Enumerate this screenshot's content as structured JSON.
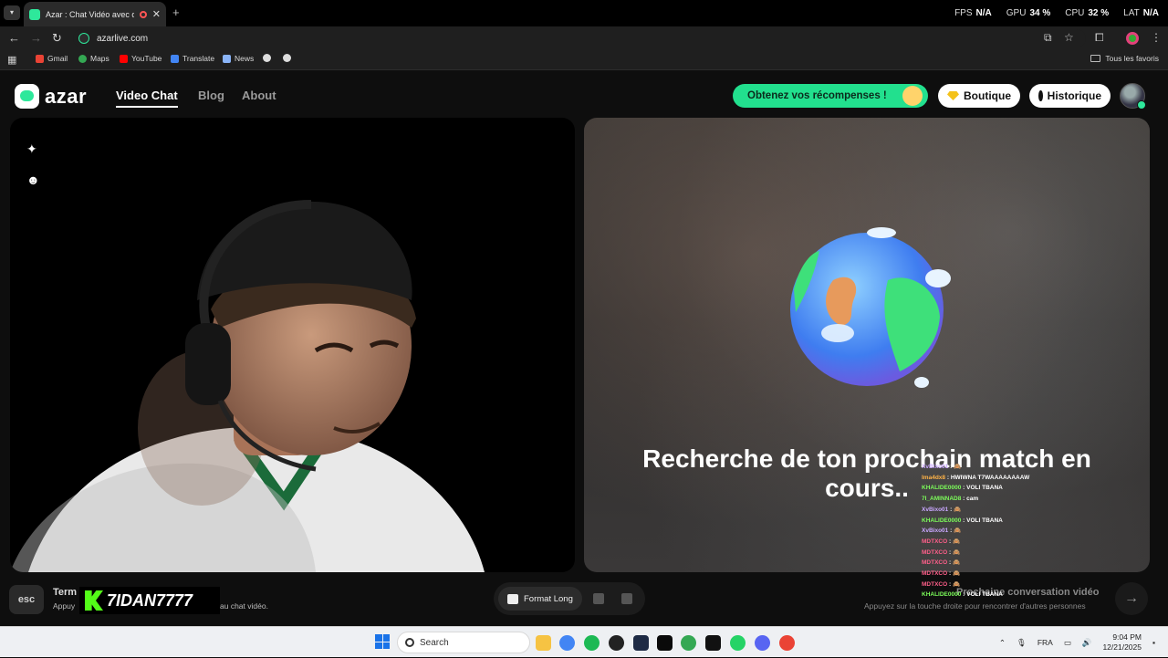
{
  "browser": {
    "tab_title": "Azar : Chat Vidéo avec de n",
    "url": "azarlive.com",
    "perf": [
      {
        "label": "FPS",
        "value": "N/A"
      },
      {
        "label": "GPU",
        "value": "34 %"
      },
      {
        "label": "CPU",
        "value": "32 %"
      },
      {
        "label": "LAT",
        "value": "N/A"
      }
    ],
    "bookmarks": [
      "Gmail",
      "Maps",
      "YouTube",
      "Translate",
      "News"
    ],
    "all_favorites": "Tous les favoris"
  },
  "site": {
    "logo_text": "azar",
    "nav": [
      "Video Chat",
      "Blog",
      "About"
    ],
    "reward_button": "Obtenez vos récompenses !",
    "shop_button": "Boutique",
    "history_button": "Historique",
    "searching_text": "Recherche de ton prochain match en cours..",
    "bottom": {
      "esc": "esc",
      "end_title": "Term",
      "end_sub_start": "Appuy",
      "end_sub_end": "au chat vidéo.",
      "format_long": "Format Long",
      "next_title": "Prochaine conversation vidéo",
      "next_sub": "Appuyez sur la touche droite pour rencontrer d'autres personnes"
    }
  },
  "overlay": {
    "streamer_name": "7IDAN7777",
    "chat": [
      {
        "user": "XvBixo01",
        "color": "#c9a7ff",
        "msg": "🙈"
      },
      {
        "user": "lma4dx8",
        "color": "#ffb347",
        "msg": "HWIWNA T7WAAAAAAAAW"
      },
      {
        "user": "KHALIDE0000",
        "color": "#7cfc5a",
        "msg": "VOLI TBANA"
      },
      {
        "user": "7I_AMINNAD8",
        "color": "#7cfc5a",
        "msg": "cam"
      },
      {
        "user": "XvBixo01",
        "color": "#c9a7ff",
        "msg": "🙈"
      },
      {
        "user": "KHALIDE0000",
        "color": "#7cfc5a",
        "msg": "VOLI TBANA"
      },
      {
        "user": "XvBixo01",
        "color": "#c9a7ff",
        "msg": "🙈"
      },
      {
        "user": "MDTXCO",
        "color": "#ff5f8a",
        "msg": "🙈"
      },
      {
        "user": "MDTXCO",
        "color": "#ff5f8a",
        "msg": "🙈"
      },
      {
        "user": "MDTXCO",
        "color": "#ff5f8a",
        "msg": "🙈"
      },
      {
        "user": "MDTXCO",
        "color": "#ff5f8a",
        "msg": "🙈"
      },
      {
        "user": "MDTXCO",
        "color": "#ff5f8a",
        "msg": "🙈"
      },
      {
        "user": "KHALIDE0000",
        "color": "#7cfc5a",
        "msg": "VOLI TBANA"
      }
    ]
  },
  "taskbar": {
    "search": "Search",
    "lang": "FRA",
    "time": "9:04 PM",
    "date": "12/21/2025"
  },
  "colors": {
    "brand_green": "#2ee89b",
    "kick_green": "#53fc18"
  }
}
